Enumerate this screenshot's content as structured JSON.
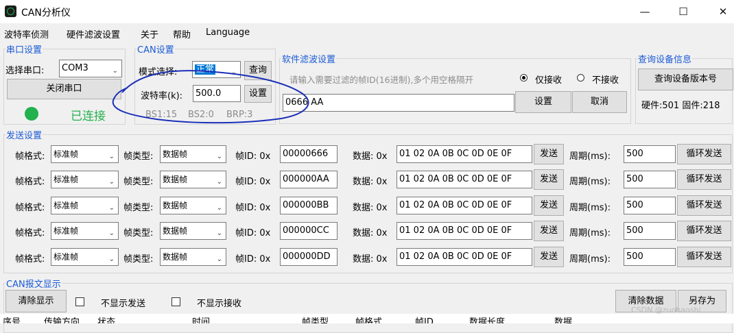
{
  "window": {
    "title": "CAN分析仪"
  },
  "menu": [
    "波特率侦测",
    "硬件滤波设置",
    "关于",
    "帮助",
    "Language"
  ],
  "serial": {
    "legend": "串口设置",
    "port_label": "选择串口:",
    "port_value": "COM3",
    "close_button": "关闭串口",
    "status": "已连接",
    "status_color": "#23b14d"
  },
  "can": {
    "legend": "CAN设置",
    "mode_label": "模式选择:",
    "mode_value": "正常",
    "query_button": "查询",
    "baud_label": "波特率(k):",
    "baud_value": "500.0",
    "set_button": "设置",
    "bs1": "BS1:15",
    "bs2": "BS2:0",
    "brp": "BRP:3"
  },
  "filter": {
    "legend": "软件滤波设置",
    "hint": "请输入需要过滤的帧ID(16进制),多个用空格隔开",
    "only_receive": "仅接收",
    "not_receive": "不接收",
    "ids_value": "0666 AA",
    "set_button": "设置",
    "cancel_button": "取消"
  },
  "device": {
    "legend": "查询设备信息",
    "version_button": "查询设备版本号",
    "hw_fw": "硬件:501 固件:218"
  },
  "send": {
    "legend": "发送设置",
    "frame_format_label": "帧格式:",
    "frame_type_label": "帧类型:",
    "id_label": "帧ID: 0x",
    "data_label": "数据: 0x",
    "send_button": "发送",
    "period_label": "周期(ms):",
    "loop_button": "循环发送",
    "rows": [
      {
        "format": "标准帧",
        "type": "数据帧",
        "id": "00000666",
        "data": "01 02 0A 0B 0C 0D 0E 0F",
        "period": "500"
      },
      {
        "format": "标准帧",
        "type": "数据帧",
        "id": "000000AA",
        "data": "01 02 0A 0B 0C 0D 0E 0F",
        "period": "500"
      },
      {
        "format": "标准帧",
        "type": "数据帧",
        "id": "000000BB",
        "data": "01 02 0A 0B 0C 0D 0E 0F",
        "period": "500"
      },
      {
        "format": "标准帧",
        "type": "数据帧",
        "id": "000000CC",
        "data": "01 02 0A 0B 0C 0D 0E 0F",
        "period": "500"
      },
      {
        "format": "标准帧",
        "type": "数据帧",
        "id": "000000DD",
        "data": "01 02 0A 0B 0C 0D 0E 0F",
        "period": "500"
      }
    ]
  },
  "display": {
    "legend": "CAN报文显示",
    "clear_button": "清除显示",
    "hide_send": "不显示发送",
    "hide_receive": "不显示接收",
    "clear_data_button": "清除数据",
    "save_as_button": "另存为",
    "columns": [
      "序号",
      "传输方向",
      "状态",
      "时间",
      "帧类型",
      "帧格式",
      "帧ID",
      "数据长度",
      "数据"
    ]
  },
  "watermark": "CSDN @zuohaoshi",
  "annotation_color": "#1a2fb8"
}
